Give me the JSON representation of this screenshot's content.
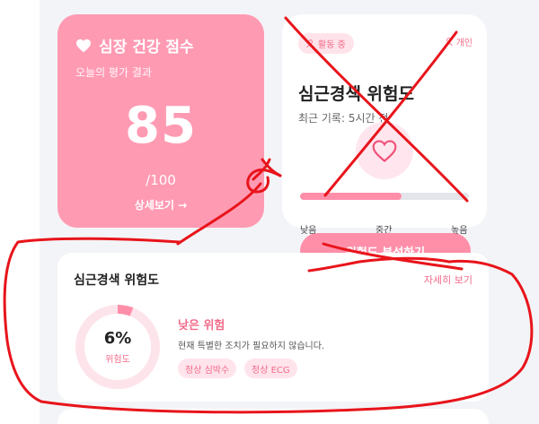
{
  "score_card": {
    "title": "심장 건강 점수",
    "subtitle": "오늘의 평가 결과",
    "score": "85",
    "max": "/100",
    "detail_label": "상세보기 →"
  },
  "risk_card": {
    "status_pill": "활동 중",
    "personal_label": "개인",
    "title": "심근경색 위험도",
    "recent": "최근 기록: 5시간 전",
    "risk_fraction": 0.6,
    "labels": {
      "low": "낮음",
      "mid": "중간",
      "high": "높음"
    }
  },
  "analyze_button": "위험도 분석하기",
  "detail_card": {
    "title": "심근경색 위험도",
    "more_label": "자세히 보기",
    "percent_value": 6,
    "percent_label": "6%",
    "ring_caption": "위험도",
    "level": "낮은 위험",
    "description": "현재 특별한 조치가 필요하지 않습니다.",
    "tags": [
      "정상 심박수",
      "정상 ECG"
    ]
  },
  "colors": {
    "accent": "#ff9ab3",
    "accent_text": "#f26b8a",
    "annotation": "#e8141b"
  },
  "icons": {
    "score_title": "heart-icon",
    "pill": "user-icon",
    "personal": "user-icon",
    "center": "heart-outline-icon"
  }
}
